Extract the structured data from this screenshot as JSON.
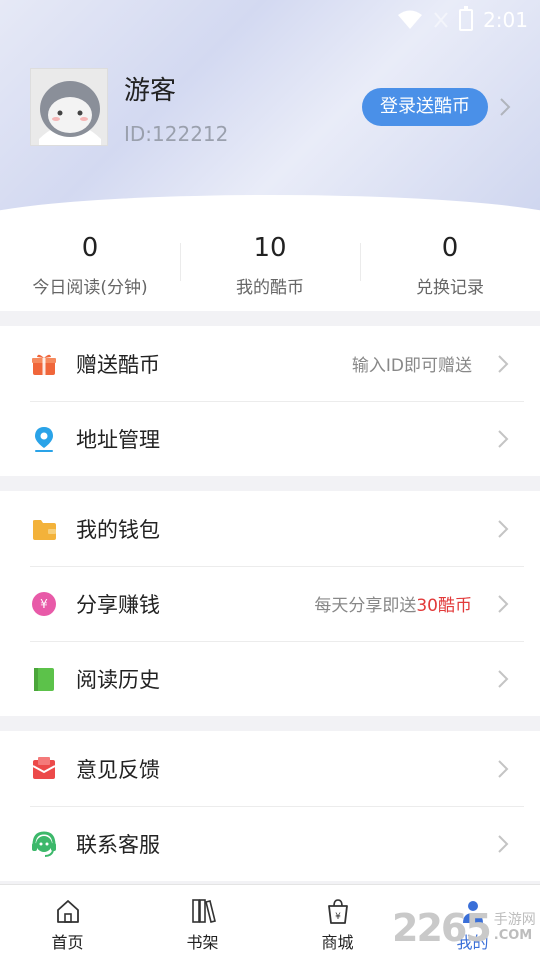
{
  "status_bar": {
    "time": "2:01"
  },
  "profile": {
    "name": "游客",
    "id_text": "ID:122212",
    "login_button": "登录送酷币"
  },
  "stats": [
    {
      "value": "0",
      "label": "今日阅读(分钟)"
    },
    {
      "value": "10",
      "label": "我的酷币"
    },
    {
      "value": "0",
      "label": "兑换记录"
    }
  ],
  "menu": {
    "gift_coins": {
      "label": "赠送酷币",
      "hint": "输入ID即可赠送",
      "icon": "gift-icon",
      "color": "#f0663a"
    },
    "address": {
      "label": "地址管理",
      "icon": "location-pin-icon",
      "color": "#2aa3e8"
    },
    "wallet": {
      "label": "我的钱包",
      "icon": "wallet-icon",
      "color": "#f3b23a"
    },
    "share": {
      "label": "分享赚钱",
      "hint_prefix": "每天分享即送",
      "hint_highlight": "30酷币",
      "icon": "share-money-icon",
      "color": "#e85aa8"
    },
    "history": {
      "label": "阅读历史",
      "icon": "book-icon",
      "color": "#5cc24a"
    },
    "feedback": {
      "label": "意见反馈",
      "icon": "mail-icon",
      "color": "#ec4a4a"
    },
    "service": {
      "label": "联系客服",
      "icon": "headset-icon",
      "color": "#3cb86a"
    }
  },
  "tabs": [
    {
      "label": "首页",
      "icon": "home-icon"
    },
    {
      "label": "书架",
      "icon": "bookshelf-icon"
    },
    {
      "label": "商城",
      "icon": "shopping-bag-icon"
    },
    {
      "label": "我的",
      "icon": "profile-icon",
      "active": true
    }
  ],
  "watermark": {
    "number": "2265",
    "cn": "手游网",
    "com": ".COM"
  }
}
